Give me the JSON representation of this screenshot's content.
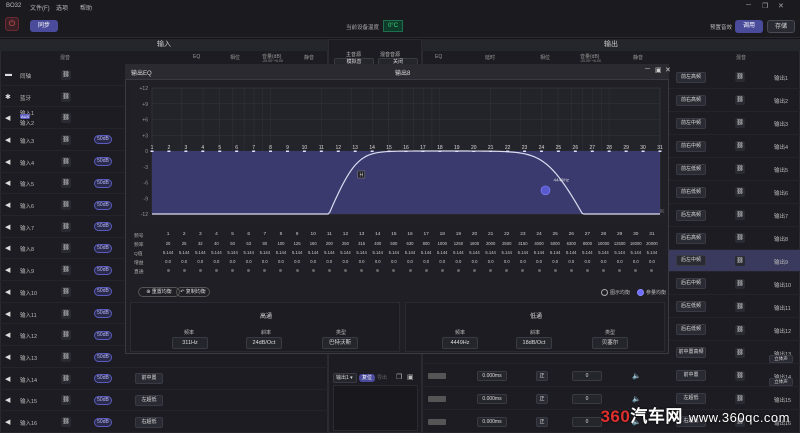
{
  "window": {
    "title": "BO32",
    "menu": [
      "文件(F)",
      "选项",
      "帮助"
    ]
  },
  "toolbar": {
    "sync_label": "同步",
    "temp_label": "当前设备温度",
    "temp_value": "0°C",
    "preset_label": "预置音效",
    "apply_label": "调用",
    "save_label": "存储"
  },
  "input_panel": {
    "title": "输入",
    "cols": {
      "mix": "混音",
      "eq": "EQ",
      "phase": "相位",
      "gain": "音量(dB)",
      "gain_range": "-20.00~+6.00",
      "mute": "静音"
    },
    "rows": [
      {
        "label": "同轴",
        "pill": ""
      },
      {
        "label": "蓝牙",
        "pill": ""
      },
      {
        "label": "输入1",
        "label2": "输入2",
        "pill": "",
        "tag": "AUX"
      },
      {
        "label": "输入3",
        "pill": "50dB"
      },
      {
        "label": "输入4",
        "pill": "50dB"
      },
      {
        "label": "输入5",
        "pill": "50dB"
      },
      {
        "label": "输入6",
        "pill": "50dB"
      },
      {
        "label": "输入7",
        "pill": "50dB"
      },
      {
        "label": "输入8",
        "pill": "50dB"
      },
      {
        "label": "输入9",
        "pill": "50dB"
      },
      {
        "label": "输入10",
        "pill": "50dB"
      },
      {
        "label": "输入11",
        "pill": "50dB"
      },
      {
        "label": "输入12",
        "pill": "50dB"
      },
      {
        "label": "输入13",
        "pill": "50dB"
      },
      {
        "label": "输入14",
        "pill": "50dB",
        "out": "前中置"
      },
      {
        "label": "输入15",
        "pill": "50dB",
        "out": "左超低"
      },
      {
        "label": "输入16",
        "pill": "50dB",
        "out": "右超低"
      }
    ]
  },
  "source": {
    "main_label": "主音源",
    "main_value": "模拟音",
    "sub_label": "混音音源",
    "sub_value": "关闭",
    "bottom_sel": "输出1",
    "bottom_btn": "复位",
    "bottom_btn2": "导出"
  },
  "output_panel": {
    "title": "输出",
    "cols": {
      "eq": "EQ",
      "delay": "延时",
      "phase": "相位",
      "gain": "音量(dB)",
      "gain_range": "-20.00~+6.00",
      "mute": "静音",
      "mix": "混音"
    },
    "rows": [
      {
        "name": "前左高频",
        "label": "输出1"
      },
      {
        "name": "前右高频",
        "label": "输出2"
      },
      {
        "name": "前左中频",
        "label": "输出3"
      },
      {
        "name": "前右中频",
        "label": "输出4"
      },
      {
        "name": "前左低频",
        "label": "输出5"
      },
      {
        "name": "前右低频",
        "label": "输出6"
      },
      {
        "name": "后左高频",
        "label": "输出7"
      },
      {
        "name": "后右高频",
        "label": "输出8"
      },
      {
        "name": "后左中频",
        "label": "输出9"
      },
      {
        "name": "后右中频",
        "label": "输出10"
      },
      {
        "name": "后左低频",
        "label": "输出11"
      },
      {
        "name": "后右低频",
        "label": "输出12"
      },
      {
        "name": "前中置高频",
        "label": "输出13",
        "btn": "立体声"
      },
      {
        "name": "前中置",
        "label": "输出14",
        "btn": "立体声",
        "delay": "0.000ms",
        "phase": "正",
        "gain": "0"
      },
      {
        "name": "左超低",
        "label": "输出15",
        "delay": "0.000ms",
        "phase": "正",
        "gain": "0"
      },
      {
        "name": "右超低",
        "label": "输出16",
        "delay": "0.000ms",
        "phase": "正",
        "gain": "0"
      }
    ],
    "phase_sym": "正",
    "gain_zero": "0",
    "delay_zero": "0.000ms"
  },
  "eq": {
    "title": "输出EQ",
    "channel": "输出8",
    "yticks": [
      "+12",
      "+9",
      "+6",
      "+3",
      "0",
      "-3",
      "-6",
      "-9",
      "-12"
    ],
    "xticks": [
      "20",
      "200",
      "2K",
      "20K"
    ],
    "xminor": [
      "30",
      "100",
      "500",
      "1K",
      "5K",
      "10K"
    ],
    "bands": [
      "1",
      "2",
      "3",
      "4",
      "5",
      "6",
      "7",
      "8",
      "9",
      "10",
      "11",
      "12",
      "13",
      "14",
      "15",
      "16",
      "17",
      "18",
      "19",
      "20",
      "21",
      "22",
      "23",
      "24",
      "25",
      "26",
      "27",
      "28",
      "29",
      "30",
      "31"
    ],
    "hp_marker": "H",
    "lp_marker_label": "4449Hz",
    "table": {
      "labels": [
        "频号",
        "频率",
        "Q值",
        "增益",
        "直通"
      ],
      "freq": [
        "20",
        "25",
        "32",
        "40",
        "50",
        "63",
        "80",
        "100",
        "125",
        "160",
        "200",
        "250",
        "315",
        "400",
        "500",
        "630",
        "800",
        "1000",
        "1250",
        "1600",
        "2000",
        "2500",
        "3150",
        "4000",
        "5000",
        "6300",
        "8000",
        "10000",
        "12500",
        "16000",
        "20000"
      ],
      "q": "5.144",
      "gain": "0.0"
    },
    "reset_label": "重置均衡",
    "copy_label": "复制均衡",
    "mode1": "图示均衡",
    "mode2": "参量均衡",
    "hp": {
      "title": "高通",
      "freq_label": "频率",
      "freq_value": "311Hz",
      "slope_label": "斜率",
      "slope_value": "24dB/Oct",
      "type_label": "类型",
      "type_value": "巴特沃斯"
    },
    "lp": {
      "title": "低通",
      "freq_label": "频率",
      "freq_value": "4449Hz",
      "slope_label": "斜率",
      "slope_value": "18dB/Oct",
      "type_label": "类型",
      "type_value": "贝塞尔"
    }
  },
  "watermark": {
    "brand_red": "360",
    "brand": "汽车网",
    "url": "www.360qc.com"
  },
  "colors": {
    "accent": "#4b4b9c",
    "curve": "#dcdcf0",
    "fill": "#3a3a6e",
    "temp": "#3bd67a"
  }
}
